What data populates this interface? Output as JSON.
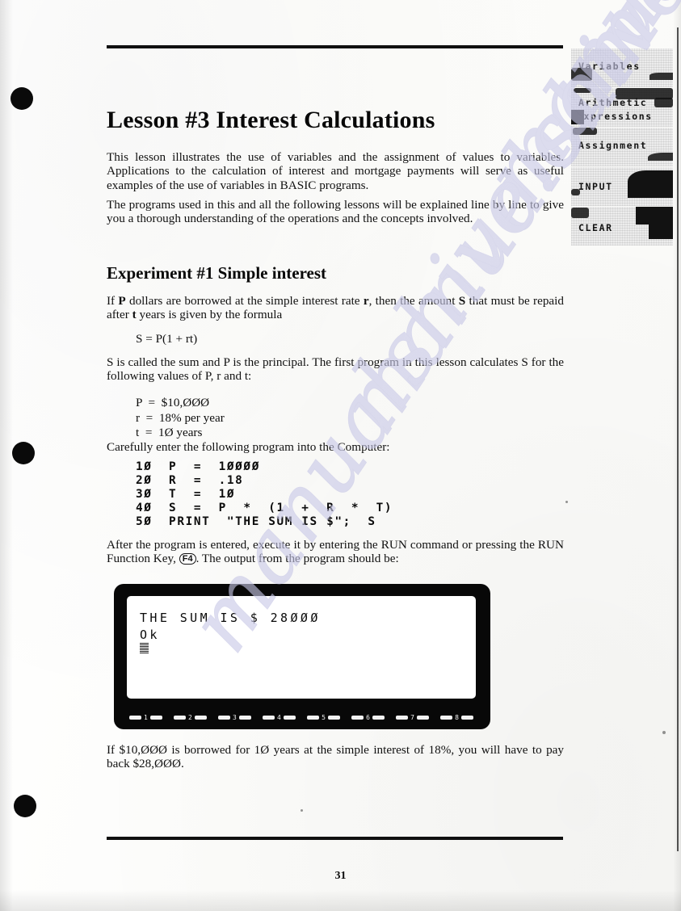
{
  "document": {
    "page_number": "31",
    "lesson_title": "Lesson #3  Interest Calculations",
    "intro_paragraph_1": "This lesson illustrates the use of variables and the assignment of values to variables. Applications to the calculation of interest and mortgage payments will serve as useful examples of the use of variables in BASIC programs.",
    "intro_paragraph_2": "The programs used in this and all the following lessons will be explained line by line to give you a thorough understanding of the operations and the concepts involved.",
    "experiment_title": "Experiment #1  Simple interest",
    "experiment_intro_a": "If ",
    "experiment_intro_b": "P",
    "experiment_intro_c": " dollars are borrowed at the simple interest rate ",
    "experiment_intro_d": "r",
    "experiment_intro_e": ", then the amount ",
    "experiment_intro_f": "S",
    "experiment_intro_g": " that must be repaid after ",
    "experiment_intro_h": "t",
    "experiment_intro_i": " years is given by the formula",
    "formula": "S  =  P(1  +  rt)",
    "explanation": "S is called the sum and P is the principal. The first program in this lesson calculates S for the following values of P, r and t:",
    "values": [
      {
        "symbol": "P",
        "equals": "=",
        "value": "$10,ØØØ"
      },
      {
        "symbol": "r",
        "equals": "=",
        "value": "18% per year"
      },
      {
        "symbol": "t",
        "equals": "=",
        "value": "1Ø years"
      }
    ],
    "enter_program_instruction": "Carefully enter the following program into the Computer:",
    "program_listing": [
      "1Ø  P  =  1ØØØØ",
      "2Ø  R  =  .18",
      "3Ø  T  =  1Ø",
      "4Ø  S  =  P  *  (1  +  R  *  T)",
      "5Ø  PRINT  \"THE SUM IS $\";  S"
    ],
    "run_paragraph_a": "After the program is entered, execute it by entering the RUN command or pressing the RUN Function Key, ",
    "run_key_label": "F4",
    "run_paragraph_b": ". The output from the program should be:",
    "conclusion": "If $10,ØØØ is borrowed for 1Ø years at the simple interest of 18%, you will have to pay back $28,ØØØ.",
    "watermark_text": "manualshive.com"
  },
  "screen": {
    "output_line": "THE SUM IS $ 28ØØØ",
    "status_line": "Ok",
    "function_keys": [
      "1",
      "2",
      "3",
      "4",
      "5",
      "6",
      "7",
      "8"
    ]
  },
  "sidebar": {
    "tabs": [
      {
        "line1": "Variables",
        "line2": ""
      },
      {
        "line1": "Arithmetic",
        "line2": "expressions"
      },
      {
        "line1": "Assignment",
        "line2": ""
      },
      {
        "line1": "INPUT",
        "line2": ""
      },
      {
        "line1": "CLEAR",
        "line2": ""
      }
    ]
  },
  "colors": {
    "ink": "#0d0d0d",
    "paper": "#fdfdfd",
    "watermark": "#c9c9e8",
    "bezel": "#080808"
  }
}
